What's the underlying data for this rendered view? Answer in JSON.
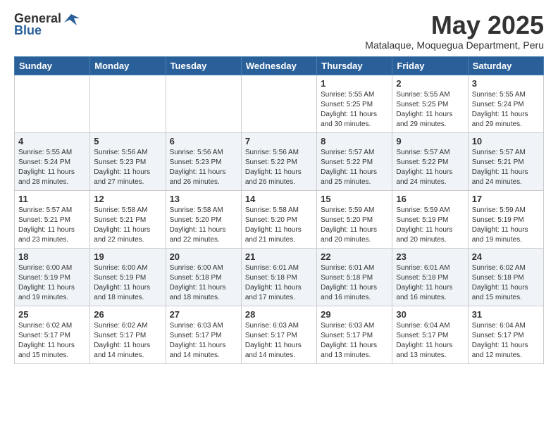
{
  "header": {
    "logo_general": "General",
    "logo_blue": "Blue",
    "month_title": "May 2025",
    "location": "Matalaque, Moquegua Department, Peru"
  },
  "days_of_week": [
    "Sunday",
    "Monday",
    "Tuesday",
    "Wednesday",
    "Thursday",
    "Friday",
    "Saturday"
  ],
  "weeks": [
    [
      {
        "day": "",
        "info": ""
      },
      {
        "day": "",
        "info": ""
      },
      {
        "day": "",
        "info": ""
      },
      {
        "day": "",
        "info": ""
      },
      {
        "day": "1",
        "info": "Sunrise: 5:55 AM\nSunset: 5:25 PM\nDaylight: 11 hours and 30 minutes."
      },
      {
        "day": "2",
        "info": "Sunrise: 5:55 AM\nSunset: 5:25 PM\nDaylight: 11 hours and 29 minutes."
      },
      {
        "day": "3",
        "info": "Sunrise: 5:55 AM\nSunset: 5:24 PM\nDaylight: 11 hours and 29 minutes."
      }
    ],
    [
      {
        "day": "4",
        "info": "Sunrise: 5:55 AM\nSunset: 5:24 PM\nDaylight: 11 hours and 28 minutes."
      },
      {
        "day": "5",
        "info": "Sunrise: 5:56 AM\nSunset: 5:23 PM\nDaylight: 11 hours and 27 minutes."
      },
      {
        "day": "6",
        "info": "Sunrise: 5:56 AM\nSunset: 5:23 PM\nDaylight: 11 hours and 26 minutes."
      },
      {
        "day": "7",
        "info": "Sunrise: 5:56 AM\nSunset: 5:22 PM\nDaylight: 11 hours and 26 minutes."
      },
      {
        "day": "8",
        "info": "Sunrise: 5:57 AM\nSunset: 5:22 PM\nDaylight: 11 hours and 25 minutes."
      },
      {
        "day": "9",
        "info": "Sunrise: 5:57 AM\nSunset: 5:22 PM\nDaylight: 11 hours and 24 minutes."
      },
      {
        "day": "10",
        "info": "Sunrise: 5:57 AM\nSunset: 5:21 PM\nDaylight: 11 hours and 24 minutes."
      }
    ],
    [
      {
        "day": "11",
        "info": "Sunrise: 5:57 AM\nSunset: 5:21 PM\nDaylight: 11 hours and 23 minutes."
      },
      {
        "day": "12",
        "info": "Sunrise: 5:58 AM\nSunset: 5:21 PM\nDaylight: 11 hours and 22 minutes."
      },
      {
        "day": "13",
        "info": "Sunrise: 5:58 AM\nSunset: 5:20 PM\nDaylight: 11 hours and 22 minutes."
      },
      {
        "day": "14",
        "info": "Sunrise: 5:58 AM\nSunset: 5:20 PM\nDaylight: 11 hours and 21 minutes."
      },
      {
        "day": "15",
        "info": "Sunrise: 5:59 AM\nSunset: 5:20 PM\nDaylight: 11 hours and 20 minutes."
      },
      {
        "day": "16",
        "info": "Sunrise: 5:59 AM\nSunset: 5:19 PM\nDaylight: 11 hours and 20 minutes."
      },
      {
        "day": "17",
        "info": "Sunrise: 5:59 AM\nSunset: 5:19 PM\nDaylight: 11 hours and 19 minutes."
      }
    ],
    [
      {
        "day": "18",
        "info": "Sunrise: 6:00 AM\nSunset: 5:19 PM\nDaylight: 11 hours and 19 minutes."
      },
      {
        "day": "19",
        "info": "Sunrise: 6:00 AM\nSunset: 5:19 PM\nDaylight: 11 hours and 18 minutes."
      },
      {
        "day": "20",
        "info": "Sunrise: 6:00 AM\nSunset: 5:18 PM\nDaylight: 11 hours and 18 minutes."
      },
      {
        "day": "21",
        "info": "Sunrise: 6:01 AM\nSunset: 5:18 PM\nDaylight: 11 hours and 17 minutes."
      },
      {
        "day": "22",
        "info": "Sunrise: 6:01 AM\nSunset: 5:18 PM\nDaylight: 11 hours and 16 minutes."
      },
      {
        "day": "23",
        "info": "Sunrise: 6:01 AM\nSunset: 5:18 PM\nDaylight: 11 hours and 16 minutes."
      },
      {
        "day": "24",
        "info": "Sunrise: 6:02 AM\nSunset: 5:18 PM\nDaylight: 11 hours and 15 minutes."
      }
    ],
    [
      {
        "day": "25",
        "info": "Sunrise: 6:02 AM\nSunset: 5:17 PM\nDaylight: 11 hours and 15 minutes."
      },
      {
        "day": "26",
        "info": "Sunrise: 6:02 AM\nSunset: 5:17 PM\nDaylight: 11 hours and 14 minutes."
      },
      {
        "day": "27",
        "info": "Sunrise: 6:03 AM\nSunset: 5:17 PM\nDaylight: 11 hours and 14 minutes."
      },
      {
        "day": "28",
        "info": "Sunrise: 6:03 AM\nSunset: 5:17 PM\nDaylight: 11 hours and 14 minutes."
      },
      {
        "day": "29",
        "info": "Sunrise: 6:03 AM\nSunset: 5:17 PM\nDaylight: 11 hours and 13 minutes."
      },
      {
        "day": "30",
        "info": "Sunrise: 6:04 AM\nSunset: 5:17 PM\nDaylight: 11 hours and 13 minutes."
      },
      {
        "day": "31",
        "info": "Sunrise: 6:04 AM\nSunset: 5:17 PM\nDaylight: 11 hours and 12 minutes."
      }
    ]
  ]
}
